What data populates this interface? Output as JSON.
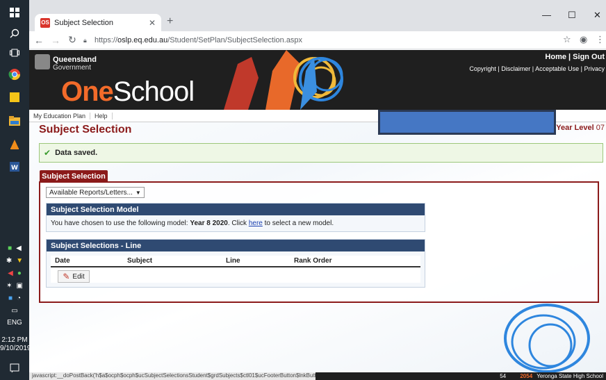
{
  "taskbar": {
    "time": "2:12 PM",
    "date": "9/10/2019",
    "lang": "ENG"
  },
  "browser": {
    "tab_title": "Subject Selection",
    "url_scheme": "https://",
    "url_host": "oslp.eq.edu.au",
    "url_path": "/Student/SetPlan/SubjectSelection.aspx"
  },
  "header": {
    "org_line1": "Queensland",
    "org_line2": "Government",
    "brand_one": "One",
    "brand_school": "School",
    "nav_home": "Home",
    "nav_signout": "Sign Out",
    "links": [
      "Copyright",
      "Disclaimer",
      "Acceptable Use",
      "Privacy"
    ]
  },
  "menu": [
    "My Education Plan",
    "Help"
  ],
  "page": {
    "title": "Subject Selection",
    "year_level_label": "Year Level",
    "year_level_value": "07",
    "message": "Data saved.",
    "tab_label": "Subject Selection",
    "reports_select": "Available Reports/Letters...",
    "model_section": {
      "heading": "Subject Selection Model",
      "text_before": "You have chosen to use the following model: ",
      "model_name": "Year 8 2020",
      "text_mid": ".  Click ",
      "link": "here",
      "text_after": " to select a new model."
    },
    "line_section": {
      "heading": "Subject Selections - Line",
      "columns": [
        "Date",
        "Subject",
        "Line",
        "Rank Order"
      ],
      "edit_label": "Edit"
    }
  },
  "status_url": "javascript:__doPostBack('h$a$ocph$ocph$ucSubjectSelectionsStudent$grdSubjects$ctl01$ucFooterButton$lnkButton','')",
  "footer": {
    "num": "54",
    "code": "2054",
    "school": "Yeronga State High School"
  }
}
